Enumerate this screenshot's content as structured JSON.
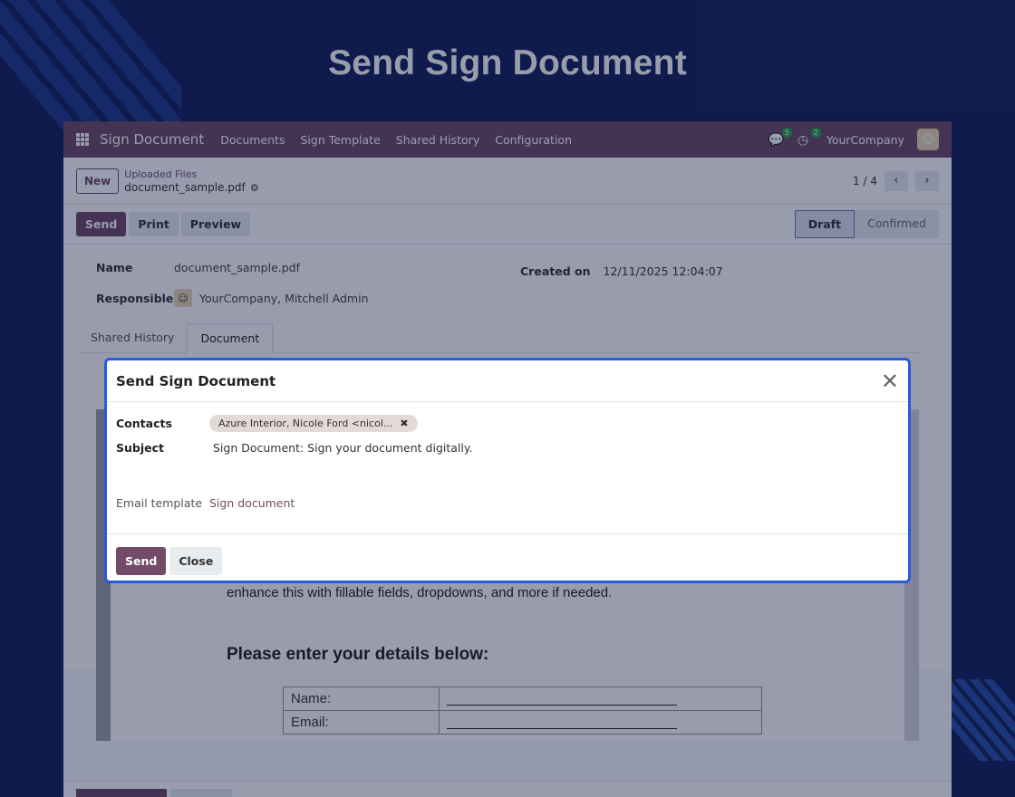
{
  "headline": "Send Sign Document",
  "topnav": {
    "brand": "Sign Document",
    "menu": [
      "Documents",
      "Sign Template",
      "Shared History",
      "Configuration"
    ],
    "messages_count": "5",
    "activities_count": "2",
    "company": "YourCompany"
  },
  "control": {
    "new_label": "New",
    "breadcrumb_parent": "Uploaded Files",
    "breadcrumb_current": "document_sample.pdf",
    "pager": "1 / 4"
  },
  "actions": {
    "send": "Send",
    "print": "Print",
    "preview": "Preview",
    "status": [
      "Draft",
      "Confirmed"
    ]
  },
  "form": {
    "name_label": "Name",
    "name_value": "document_sample.pdf",
    "created_label": "Created on",
    "created_value": "12/11/2025 12:04:07",
    "responsible_label": "Responsible",
    "responsible_value": "YourCompany, Mitchell Admin",
    "tabs": [
      "Shared History",
      "Document"
    ]
  },
  "document": {
    "text_line": "enhance this with fillable fields, dropdowns, and more if needed.",
    "heading": "Please enter your details below:",
    "rows": [
      "Name:",
      "Email:"
    ]
  },
  "modal": {
    "title": "Send Sign Document",
    "contacts_label": "Contacts",
    "contact_tag": "Azure Interior, Nicole Ford <nicol...",
    "subject_label": "Subject",
    "subject_value": "Sign Document: Sign your document digitally.",
    "template_label": "Email template",
    "template_value": "Sign document",
    "send_label": "Send",
    "close_label": "Close"
  },
  "colors": {
    "background": "#132158",
    "brand": "#714b67",
    "modal_border": "#2a5bd7"
  }
}
